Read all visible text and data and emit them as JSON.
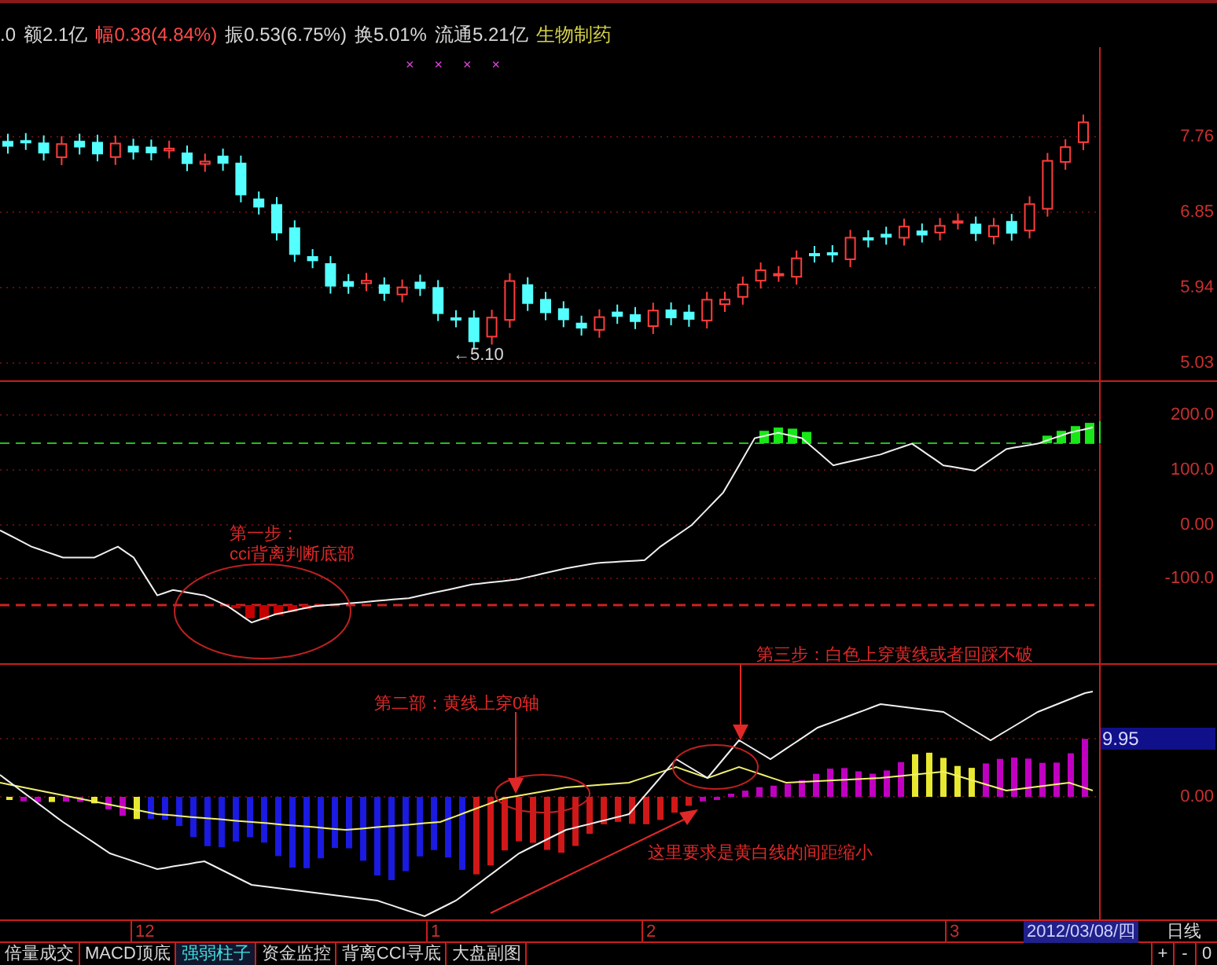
{
  "quote_bar": {
    "items": [
      {
        "text": ".0",
        "kind": "neutral"
      },
      {
        "text": "额2.1亿",
        "kind": "neutral"
      },
      {
        "text": "幅0.38(4.84%)",
        "kind": "rise"
      },
      {
        "text": "振0.53(6.75%)",
        "kind": "neutral"
      },
      {
        "text": "换5.01%",
        "kind": "neutral"
      },
      {
        "text": "流通5.21亿",
        "kind": "neutral"
      },
      {
        "text": "生物制药",
        "kind": "sector"
      }
    ],
    "markers": [
      "×",
      "×",
      "×",
      "×"
    ]
  },
  "price_panel": {
    "axis_labels": [
      "7.76",
      "6.85",
      "5.94",
      "5.03"
    ],
    "low_label": "←5.10"
  },
  "cci_panel": {
    "axis_labels": [
      "200.0",
      "100.0",
      "0.00",
      "-100.0"
    ],
    "note_title": "第一步：",
    "note_body": "cci背离判断底部"
  },
  "strength_panel": {
    "value_badge": "9.95",
    "axis_labels": [
      "0.00"
    ],
    "notes": [
      "第二部：黄线上穿0轴",
      "第三步：白色上穿黄线或者回踩不破",
      "这里要求是黄白线的间距缩小"
    ]
  },
  "x_axis": {
    "labels": [
      "12",
      "1",
      "2",
      "3"
    ],
    "date": "2012/03/08/四",
    "period": "日线"
  },
  "tabs": [
    {
      "label": "倍量成交",
      "selected": false
    },
    {
      "label": "MACD顶底",
      "selected": false
    },
    {
      "label": "强弱柱子",
      "selected": true
    },
    {
      "label": "资金监控",
      "selected": false
    },
    {
      "label": "背离CCI寻底",
      "selected": false
    },
    {
      "label": "大盘副图",
      "selected": false
    }
  ],
  "zoom_buttons": [
    "+",
    "-",
    "0"
  ]
}
